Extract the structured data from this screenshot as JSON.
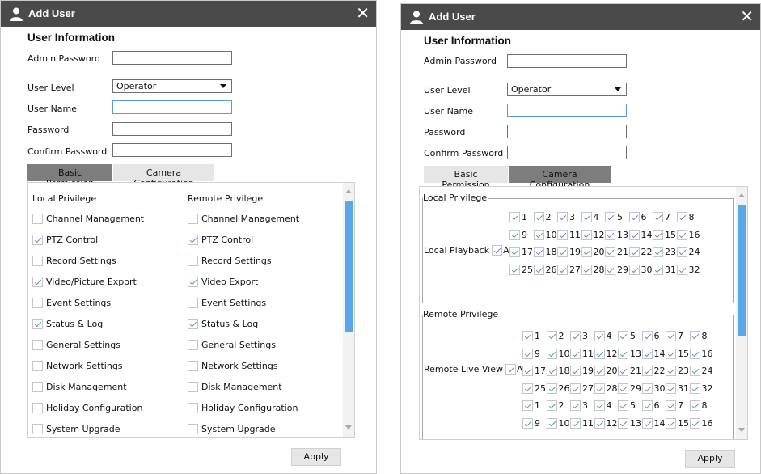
{
  "left": {
    "title": "Add User",
    "section_title": "User Information",
    "fields": {
      "admin_password_label": "Admin Password",
      "user_level_label": "User Level",
      "user_level_value": "Operator",
      "user_name_label": "User Name",
      "password_label": "Password",
      "confirm_password_label": "Confirm Password"
    },
    "tabs": {
      "basic": "Basic Permission",
      "camera": "Camera Configuration"
    },
    "local_header": "Local Privilege",
    "remote_header": "Remote Privilege",
    "local_items": [
      {
        "label": "Channel Management",
        "checked": false
      },
      {
        "label": "PTZ Control",
        "checked": true
      },
      {
        "label": "Record Settings",
        "checked": false
      },
      {
        "label": "Video/Picture Export",
        "checked": true
      },
      {
        "label": "Event Settings",
        "checked": false
      },
      {
        "label": "Status & Log",
        "checked": true
      },
      {
        "label": "General Settings",
        "checked": false
      },
      {
        "label": "Network Settings",
        "checked": false
      },
      {
        "label": "Disk Management",
        "checked": false
      },
      {
        "label": "Holiday Configuration",
        "checked": false
      },
      {
        "label": "System Upgrade",
        "checked": false
      }
    ],
    "remote_items": [
      {
        "label": "Channel Management",
        "checked": false
      },
      {
        "label": "PTZ Control",
        "checked": true
      },
      {
        "label": "Record Settings",
        "checked": false
      },
      {
        "label": "Video Export",
        "checked": true
      },
      {
        "label": "Event Settings",
        "checked": false
      },
      {
        "label": "Status & Log",
        "checked": true
      },
      {
        "label": "General Settings",
        "checked": false
      },
      {
        "label": "Network Settings",
        "checked": false
      },
      {
        "label": "Disk Management",
        "checked": false
      },
      {
        "label": "Holiday Configuration",
        "checked": false
      },
      {
        "label": "System Upgrade",
        "checked": false
      }
    ],
    "apply_label": "Apply"
  },
  "right": {
    "title": "Add User",
    "section_title": "User Information",
    "fields": {
      "admin_password_label": "Admin Password",
      "user_level_label": "User Level",
      "user_level_value": "Operator",
      "user_name_label": "User Name",
      "password_label": "Password",
      "confirm_password_label": "Confirm Password"
    },
    "tabs": {
      "basic": "Basic Permission",
      "camera": "Camera Configuration"
    },
    "local_privilege": {
      "legend": "Local Privilege",
      "row_label": "Local Playback",
      "all_label": "All",
      "all_checked": true,
      "channels": [
        "1",
        "2",
        "3",
        "4",
        "5",
        "6",
        "7",
        "8",
        "9",
        "10",
        "11",
        "12",
        "13",
        "14",
        "15",
        "16",
        "17",
        "18",
        "19",
        "20",
        "21",
        "22",
        "23",
        "24",
        "25",
        "26",
        "27",
        "28",
        "29",
        "30",
        "31",
        "32"
      ]
    },
    "remote_privilege": {
      "legend": "Remote Privilege",
      "row_label": "Remote Live View",
      "all_label": "All",
      "all_checked": true,
      "channels": [
        "1",
        "2",
        "3",
        "4",
        "5",
        "6",
        "7",
        "8",
        "9",
        "10",
        "11",
        "12",
        "13",
        "14",
        "15",
        "16",
        "17",
        "18",
        "19",
        "20",
        "21",
        "22",
        "23",
        "24",
        "25",
        "26",
        "27",
        "28",
        "29",
        "30",
        "31",
        "32"
      ],
      "next_channels_visible": [
        "1",
        "2",
        "3",
        "4",
        "5",
        "6",
        "7",
        "8",
        "9",
        "10",
        "11",
        "12",
        "13",
        "14",
        "15",
        "16"
      ]
    },
    "apply_label": "Apply"
  },
  "colors": {
    "titlebar": "#4a4a4a",
    "tab_active": "#7d7d7d",
    "tab_inactive": "#e6e6e6",
    "check": "#5c8fd6",
    "scroll_thumb": "#5ba8e8",
    "focus_border": "#5b9bd5"
  },
  "icons": {
    "user": "user-icon",
    "close": "close-icon",
    "dropdown": "chevron-down-icon"
  }
}
